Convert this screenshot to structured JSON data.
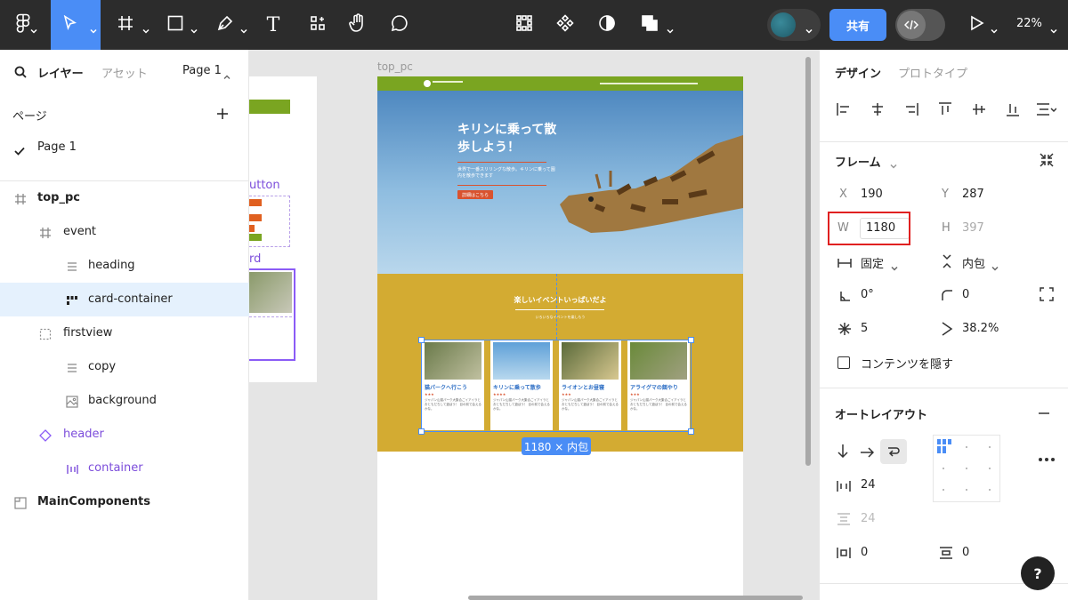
{
  "toolbar": {
    "share_label": "共有",
    "zoom": "22%",
    "text_tool_glyph": "T"
  },
  "left_panel": {
    "tabs": {
      "layers": "レイヤー",
      "assets": "アセット",
      "page_selector": "Page 1"
    },
    "pages_title": "ページ",
    "pages": [
      {
        "label": "Page 1",
        "checked": true
      }
    ],
    "layers": [
      {
        "label": "top_pc",
        "type": "frame",
        "depth": 0
      },
      {
        "label": "event",
        "type": "frame",
        "depth": 1
      },
      {
        "label": "heading",
        "type": "text",
        "depth": 2
      },
      {
        "label": "card-container",
        "type": "auto-layout",
        "depth": 2,
        "selected": true
      },
      {
        "label": "firstview",
        "type": "frame",
        "depth": 1
      },
      {
        "label": "copy",
        "type": "text",
        "depth": 2
      },
      {
        "label": "background",
        "type": "image",
        "depth": 2
      },
      {
        "label": "header",
        "type": "component",
        "depth": 1
      },
      {
        "label": "container",
        "type": "auto-layout",
        "depth": 2
      },
      {
        "label": "MainComponents",
        "type": "section",
        "depth": 0
      }
    ]
  },
  "canvas": {
    "frame_label": "top_pc",
    "side_labels": {
      "button": "utton",
      "card": "rd"
    },
    "hero": {
      "title": "キリンに乗って散歩しよう！",
      "copy": "世界で一番スリリングな散歩。キリンに乗って園内を散歩できます",
      "button": "詳細はこちら"
    },
    "event": {
      "heading": "楽しいイベントいっぱいだよ",
      "sub": "いろいろなイベントを楽しもう",
      "cards": [
        {
          "title": "猫パークへ行こう",
          "stars": "★★★",
          "text": "ジャパン山猫パーク大集合ごイアイラとおともだちして遊ぼう！ 目の前で会えるかな。",
          "img_color": "#8a9a6a"
        },
        {
          "title": "キリンに乗って散歩",
          "stars": "★★★★",
          "text": "ジャパン山猫パーク大集合ごイアイラとおともだちして遊ぼう！ 目の前で会えるかな。",
          "img_color": "#7fb4da"
        },
        {
          "title": "ライオンとお昼寝",
          "stars": "★★★",
          "text": "ジャパン山猫パーク大集合ごイアイラとおともだちして遊ぼう！ 目の前で会えるかな。",
          "img_color": "#b8a06a"
        },
        {
          "title": "アライグマの餌やり",
          "stars": "★★★",
          "text": "ジャパン山猫パーク大集合ごイアイラとおともだちして遊ぼう！ 目の前で会えるかな。",
          "img_color": "#7a8a5a"
        }
      ]
    },
    "dimension_badge": "1180 × 内包"
  },
  "right_panel": {
    "tabs": {
      "design": "デザイン",
      "prototype": "プロトタイプ"
    },
    "frame_section": "フレーム",
    "x_label": "X",
    "x_value": "190",
    "y_label": "Y",
    "y_value": "287",
    "w_label": "W",
    "w_value": "1180",
    "h_label": "H",
    "h_value": "397",
    "width_mode": "固定",
    "height_mode": "内包",
    "rotation": "0°",
    "radius": "0",
    "star_count": "5",
    "ratio": "38.2%",
    "clip_label": "コンテンツを隠す",
    "autolayout_section": "オートレイアウト",
    "gap": "24",
    "gap_vertical": "24",
    "padding_h": "0",
    "padding_v": "0",
    "help": "?"
  },
  "colors": {
    "accent": "#4a8df6",
    "toolbar_bg": "#2c2c2c",
    "highlight": "#e02020",
    "event_bg": "#d3ab32",
    "header_green": "#7aa521"
  }
}
